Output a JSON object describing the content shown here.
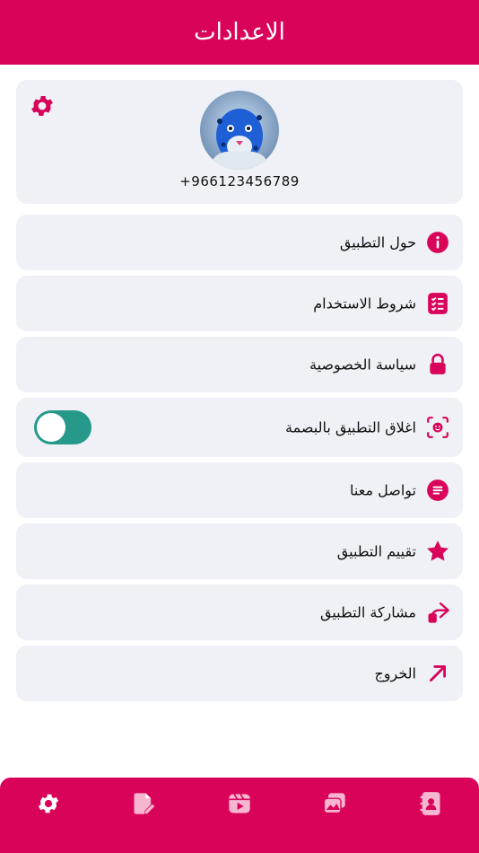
{
  "header": {
    "title": "الاعدادات"
  },
  "profile": {
    "phone": "+966123456789",
    "avatar_icon": "leopard-avatar",
    "settings_icon": "gear-icon"
  },
  "menu": [
    {
      "label": "حول التطبيق",
      "icon": "info-icon"
    },
    {
      "label": "شروط الاستخدام",
      "icon": "checklist-icon"
    },
    {
      "label": "سياسة الخصوصية",
      "icon": "lock-icon"
    },
    {
      "label": "اغلاق التطبيق بالبصمة",
      "icon": "face-id-icon",
      "toggle_on": true
    },
    {
      "label": "تواصل معنا",
      "icon": "chat-icon"
    },
    {
      "label": "تقييم التطبيق",
      "icon": "star-icon"
    },
    {
      "label": "مشاركة التطبيق",
      "icon": "share-icon"
    },
    {
      "label": "الخروج",
      "icon": "arrow-up-right-icon"
    }
  ],
  "bottom_nav": [
    {
      "icon": "settings-icon",
      "active": true
    },
    {
      "icon": "edit-document-icon",
      "active": false
    },
    {
      "icon": "video-icon",
      "active": false
    },
    {
      "icon": "gallery-icon",
      "active": false
    },
    {
      "icon": "contacts-icon",
      "active": false
    }
  ],
  "colors": {
    "accent": "#d9045a",
    "card_bg": "#eff1f7",
    "toggle_on": "#26998a"
  }
}
